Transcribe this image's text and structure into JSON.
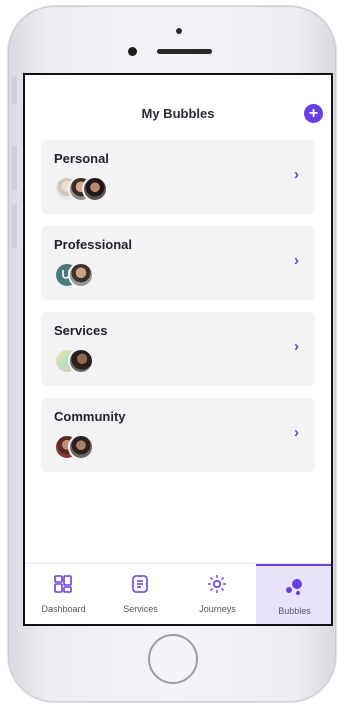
{
  "header": {
    "title": "My Bubbles",
    "add_label": "+"
  },
  "bubbles": [
    {
      "label": "Personal",
      "chevron": "›"
    },
    {
      "label": "Professional",
      "chevron": "›"
    },
    {
      "label": "Services",
      "chevron": "›"
    },
    {
      "label": "Community",
      "chevron": "›"
    }
  ],
  "tabs": [
    {
      "label": "Dashboard",
      "icon": "dashboard-icon",
      "active": false
    },
    {
      "label": "Services",
      "icon": "services-icon",
      "active": false
    },
    {
      "label": "Journeys",
      "icon": "journeys-icon",
      "active": false
    },
    {
      "label": "Bubbles",
      "icon": "bubbles-icon",
      "active": true
    }
  ],
  "colors": {
    "accent": "#6a3fe0",
    "card_bg": "#f3f3f6",
    "active_tab_bg": "#e9e2fb"
  }
}
